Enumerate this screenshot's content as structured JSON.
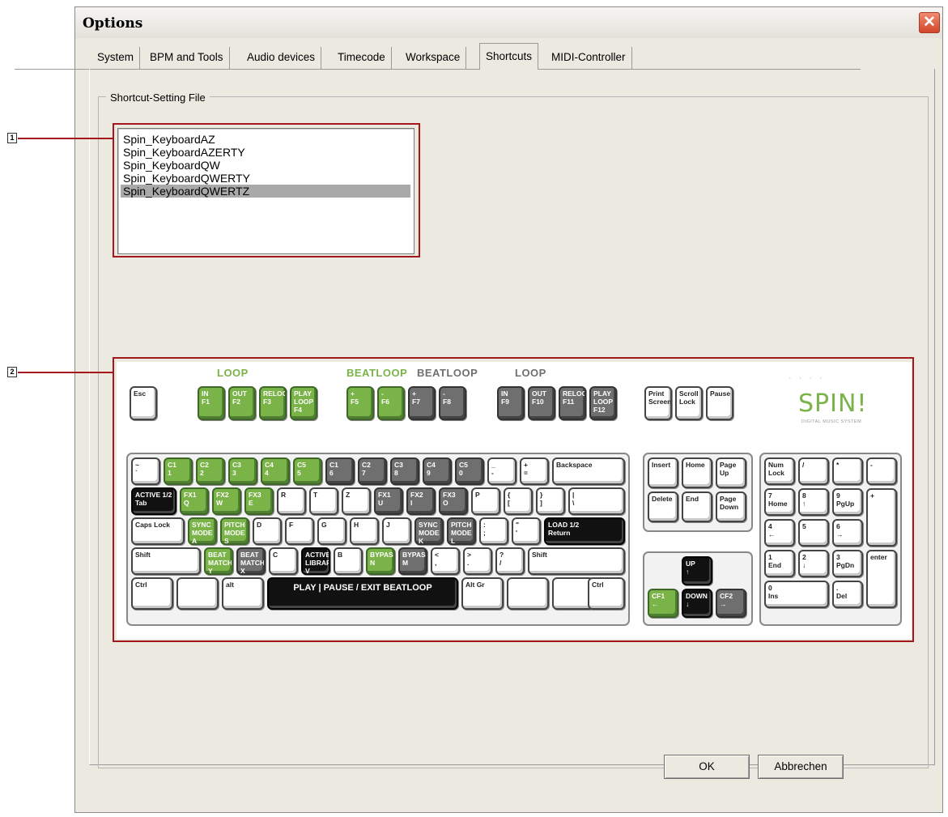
{
  "window": {
    "title": "Options",
    "close_glyph": "✕"
  },
  "tabs": [
    {
      "label": "System"
    },
    {
      "label": "BPM and Tools"
    },
    {
      "label": "Audio devices"
    },
    {
      "label": "Timecode"
    },
    {
      "label": "Workspace"
    },
    {
      "label": "Shortcuts",
      "active": true
    },
    {
      "label": "MIDI-Controller"
    }
  ],
  "group": {
    "legend": "Shortcut-Setting File"
  },
  "callouts": [
    "1",
    "2"
  ],
  "listbox": {
    "items": [
      "Spin_KeyboardAZ",
      "Spin_KeyboardAZERTY",
      "Spin_KeyboardQW",
      "Spin_KeyboardQWERTY",
      "Spin_KeyboardQWERTZ"
    ],
    "selected_index": 4
  },
  "keyboard": {
    "group_labels": {
      "loop1": "LOOP",
      "beatloop1": "BEATLOOP",
      "beatloop2": "BEATLOOP",
      "loop2": "LOOP"
    },
    "logo": {
      "text": "SPIN!",
      "sub": "DIGITAL MUSIC SYSTEM"
    },
    "keys": {
      "esc": "Esc",
      "f1": "IN\nF1",
      "f2": "OUT\nF2",
      "f3": "RELOOP\nF3",
      "f4": "PLAY LOOP\nF4",
      "f5": "+\nF5",
      "f6": "-\nF6",
      "f7": "+\nF7",
      "f8": "-\nF8",
      "f9": "IN\nF9",
      "f10": "OUT\nF10",
      "f11": "RELOOP\nF11",
      "f12": "PLAY LOOP\nF12",
      "print": "Print\nScreen",
      "scroll": "Scroll\nLock",
      "pause": "Pause",
      "tilde": "~\n`",
      "n1": "C1\n1",
      "n2": "C2\n2",
      "n3": "C3\n3",
      "n4": "C4\n4",
      "n5": "C5\n5",
      "n6": "C1\n6",
      "n7": "C2\n7",
      "n8": "C3\n8",
      "n9": "C4\n9",
      "n0": "C5\n0",
      "minus": "_\n-",
      "equals": "+\n=",
      "backspace": "Backspace",
      "tab": "ACTIVE 1/2\nTab",
      "q": "FX1\nQ",
      "w": "FX2\nW",
      "e": "FX3\nE",
      "r": "R",
      "t": "T",
      "z": "Z",
      "u": "FX1\nU",
      "i": "FX2\nI",
      "o": "FX3\nO",
      "p": "P",
      "lbracket": "{\n[",
      "rbracket": "}\n]",
      "backslash": "|\n\\",
      "caps": "Caps Lock",
      "a": "SYNC MODE\nA",
      "s": "PITCH MODE\nS",
      "d": "D",
      "f": "F",
      "g": "G",
      "h": "H",
      "j": "J",
      "k": "SYNC MODE\nK",
      "l": "PITCH MODE\nL",
      "semicolon": ":\n;",
      "quote": "\"\n'",
      "return": "LOAD 1/2\nReturn",
      "lshift": "Shift",
      "y": "BEAT MATCH\nY",
      "x": "BEAT MATCH\nX",
      "c": "C",
      "v": "ACTIVE LIBRARY\nV",
      "b": "B",
      "n": "BYPASS\nN",
      "m": "BYPASS\nM",
      "comma": "<\n,",
      "period": ">\n.",
      "slash": "?\n/",
      "rshift": "Shift",
      "lctrl": "Ctrl",
      "lwin": "",
      "alt": "alt",
      "space": "PLAY | PAUSE / EXIT BEATLOOP",
      "altgr": "Alt Gr",
      "rwin": "",
      "menu": "",
      "rctrl": "Ctrl",
      "insert": "Insert",
      "home": "Home",
      "pgup": "Page\nUp",
      "delete": "Delete",
      "end": "End",
      "pgdn": "Page\nDown",
      "up": "UP\n↑",
      "left": "CF1\n←",
      "down": "DOWN\n↓",
      "right": "CF2\n→",
      "numlock": "Num\nLock",
      "ndiv": "/",
      "nmul": "*",
      "nminus": "-",
      "n7k": "7\nHome",
      "n8k": "8\n↑",
      "n9k": "9\nPgUp",
      "nplus": "+",
      "n4k": "4\n←",
      "n5k": "5",
      "n6k": "6\n→",
      "n1k": "1\nEnd",
      "n2k": "2\n↓",
      "n3k": "3\nPgDn",
      "nenter": "enter",
      "n0k": "0\nIns",
      "ndel": ".\nDel"
    }
  },
  "buttons": {
    "ok": "OK",
    "cancel": "Abbrechen"
  }
}
